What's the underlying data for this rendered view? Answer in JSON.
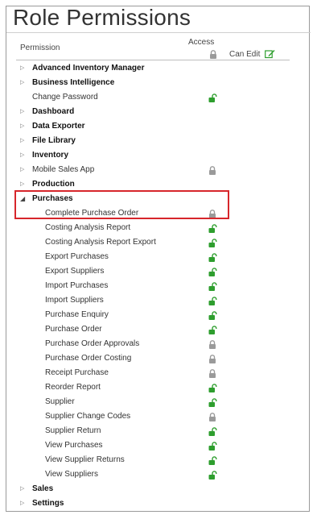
{
  "title": "Role Permissions",
  "header": {
    "permission": "Permission",
    "access": "Access",
    "can_edit": "Can Edit"
  },
  "colors": {
    "unlocked": "#2e9e2e",
    "locked": "#9a9a9a",
    "highlight": "#d7262b"
  },
  "rows": [
    {
      "label": "Advanced Inventory Manager",
      "type": "group",
      "expanded": false,
      "access": "none"
    },
    {
      "label": "Business Intelligence",
      "type": "group",
      "expanded": false,
      "access": "none"
    },
    {
      "label": "Change Password",
      "type": "leaf-root",
      "access": "unlocked"
    },
    {
      "label": "Dashboard",
      "type": "group",
      "expanded": false,
      "access": "none"
    },
    {
      "label": "Data Exporter",
      "type": "group",
      "expanded": false,
      "access": "none"
    },
    {
      "label": "File Library",
      "type": "group",
      "expanded": false,
      "access": "none"
    },
    {
      "label": "Inventory",
      "type": "group",
      "expanded": false,
      "access": "none"
    },
    {
      "label": "Mobile Sales App",
      "type": "leaf-root-caret",
      "access": "locked"
    },
    {
      "label": "Production",
      "type": "group",
      "expanded": false,
      "access": "none"
    },
    {
      "label": "Purchases",
      "type": "group",
      "expanded": true,
      "access": "none"
    },
    {
      "label": "Complete Purchase Order",
      "type": "child",
      "access": "locked"
    },
    {
      "label": "Costing Analysis Report",
      "type": "child",
      "access": "unlocked"
    },
    {
      "label": "Costing Analysis Report Export",
      "type": "child",
      "access": "unlocked"
    },
    {
      "label": "Export Purchases",
      "type": "child",
      "access": "unlocked"
    },
    {
      "label": "Export Suppliers",
      "type": "child",
      "access": "unlocked"
    },
    {
      "label": "Import Purchases",
      "type": "child",
      "access": "unlocked"
    },
    {
      "label": "Import Suppliers",
      "type": "child",
      "access": "unlocked"
    },
    {
      "label": "Purchase Enquiry",
      "type": "child",
      "access": "unlocked"
    },
    {
      "label": "Purchase Order",
      "type": "child",
      "access": "unlocked"
    },
    {
      "label": "Purchase Order Approvals",
      "type": "child",
      "access": "locked"
    },
    {
      "label": "Purchase Order Costing",
      "type": "child",
      "access": "locked"
    },
    {
      "label": "Receipt Purchase",
      "type": "child",
      "access": "locked"
    },
    {
      "label": "Reorder Report",
      "type": "child",
      "access": "unlocked"
    },
    {
      "label": "Supplier",
      "type": "child",
      "access": "unlocked"
    },
    {
      "label": "Supplier Change Codes",
      "type": "child",
      "access": "locked"
    },
    {
      "label": "Supplier Return",
      "type": "child",
      "access": "unlocked"
    },
    {
      "label": "View Purchases",
      "type": "child",
      "access": "unlocked"
    },
    {
      "label": "View Supplier Returns",
      "type": "child",
      "access": "unlocked"
    },
    {
      "label": "View Suppliers",
      "type": "child",
      "access": "unlocked"
    },
    {
      "label": "Sales",
      "type": "group",
      "expanded": false,
      "access": "none"
    },
    {
      "label": "Settings",
      "type": "group",
      "expanded": false,
      "access": "none"
    }
  ]
}
